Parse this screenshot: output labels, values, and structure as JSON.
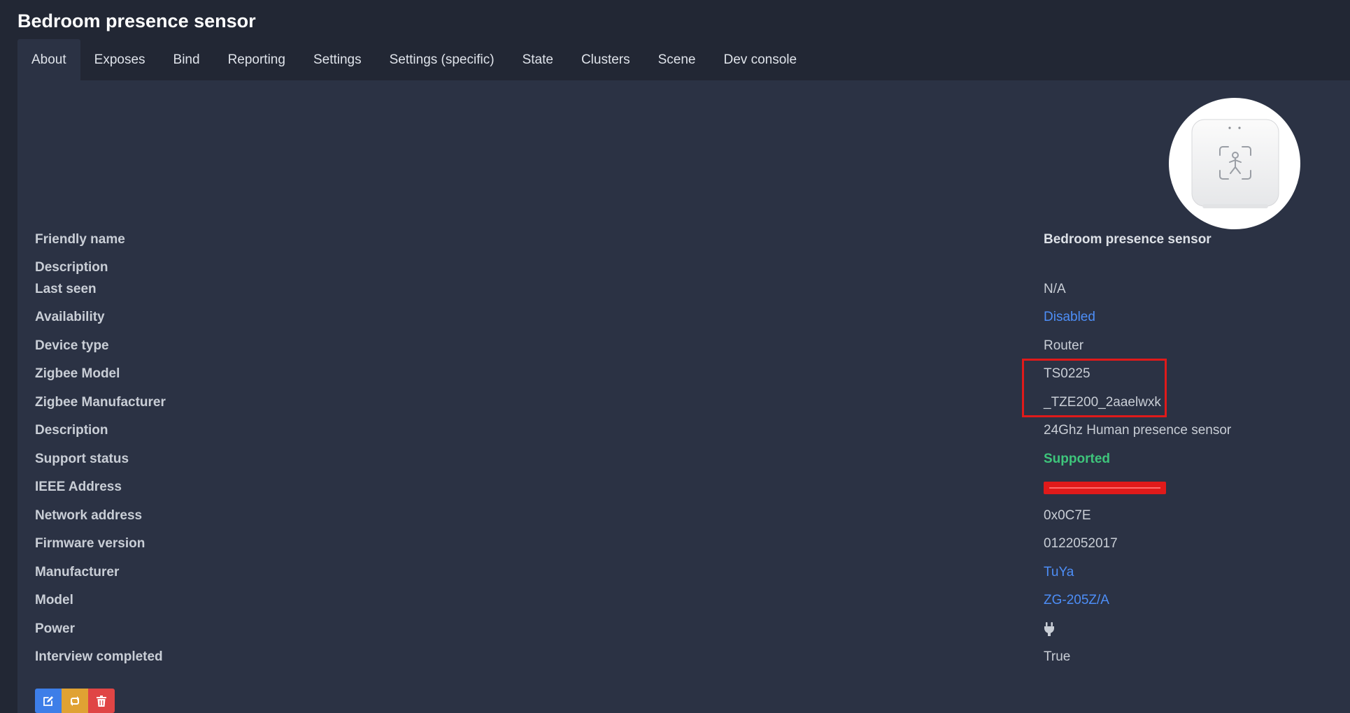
{
  "page": {
    "title": "Bedroom presence sensor"
  },
  "tabs": [
    {
      "label": "About",
      "active": true
    },
    {
      "label": "Exposes"
    },
    {
      "label": "Bind"
    },
    {
      "label": "Reporting"
    },
    {
      "label": "Settings"
    },
    {
      "label": "Settings (specific)"
    },
    {
      "label": "State"
    },
    {
      "label": "Clusters"
    },
    {
      "label": "Scene"
    },
    {
      "label": "Dev console"
    }
  ],
  "info": {
    "friendly_name": {
      "label": "Friendly name",
      "value": "Bedroom presence sensor"
    },
    "description_user": {
      "label": "Description",
      "value": ""
    },
    "last_seen": {
      "label": "Last seen",
      "value": "N/A"
    },
    "availability": {
      "label": "Availability",
      "value": "Disabled"
    },
    "device_type": {
      "label": "Device type",
      "value": "Router"
    },
    "zigbee_model": {
      "label": "Zigbee Model",
      "value": "TS0225"
    },
    "zigbee_manufacturer": {
      "label": "Zigbee Manufacturer",
      "value": "_TZE200_2aaelwxk"
    },
    "description": {
      "label": "Description",
      "value": "24Ghz Human presence sensor"
    },
    "support_status": {
      "label": "Support status",
      "value": "Supported"
    },
    "ieee_address": {
      "label": "IEEE Address",
      "value": ""
    },
    "network_address": {
      "label": "Network address",
      "value": "0x0C7E"
    },
    "firmware_version": {
      "label": "Firmware version",
      "value": "0122052017"
    },
    "manufacturer": {
      "label": "Manufacturer",
      "value": "TuYa"
    },
    "model": {
      "label": "Model",
      "value": "ZG-205Z/A"
    },
    "power": {
      "label": "Power",
      "icon": "plug-icon"
    },
    "interview_completed": {
      "label": "Interview completed",
      "value": "True"
    }
  },
  "colors": {
    "link": "#4d8ef7",
    "supported": "#3ec57b",
    "annotation_red": "#e01a1a",
    "edit_button": "#3d7ee8",
    "reconfigure_button": "#e0a233",
    "delete_button": "#e04545"
  },
  "actions": {
    "edit_icon": "edit-icon",
    "reconfigure_icon": "refresh-icon",
    "delete_icon": "trash-icon"
  }
}
